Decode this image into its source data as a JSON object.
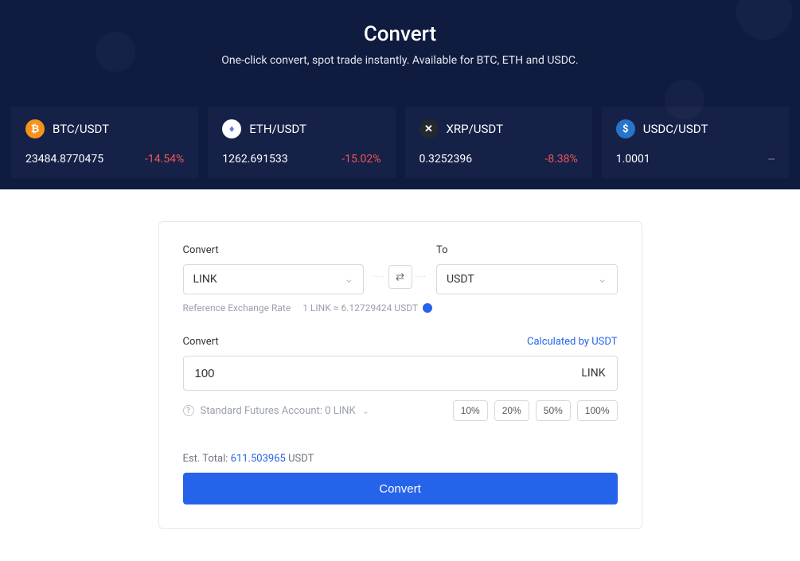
{
  "hero": {
    "title": "Convert",
    "subtitle": "One-click convert, spot trade instantly. Available for BTC, ETH and USDC."
  },
  "tickers": [
    {
      "pair": "BTC/USDT",
      "price": "23484.8770475",
      "change": "-14.54%",
      "changeClass": "neg",
      "iconClass": "coin-btc",
      "iconGlyph": "₿"
    },
    {
      "pair": "ETH/USDT",
      "price": "1262.691533",
      "change": "-15.02%",
      "changeClass": "neg",
      "iconClass": "coin-eth",
      "iconGlyph": "♦"
    },
    {
      "pair": "XRP/USDT",
      "price": "0.3252396",
      "change": "-8.38%",
      "changeClass": "neg",
      "iconClass": "coin-xrp",
      "iconGlyph": "✕"
    },
    {
      "pair": "USDC/USDT",
      "price": "1.0001",
      "change": "--",
      "changeClass": "neutral",
      "iconClass": "coin-usdc",
      "iconGlyph": "$"
    }
  ],
  "form": {
    "fromLabel": "Convert",
    "toLabel": "To",
    "fromValue": "LINK",
    "toValue": "USDT",
    "rateLabel": "Reference Exchange Rate",
    "rateText": "1 LINK ≈ 6.12729424 USDT",
    "amountLabel": "Convert",
    "calcBy": "Calculated by USDT",
    "amountValue": "100",
    "amountUnit": "LINK",
    "accountText": "Standard Futures Account: 0 LINK",
    "pct": [
      "10%",
      "20%",
      "50%",
      "100%"
    ],
    "estLabel": "Est. Total: ",
    "estValue": "611.503965",
    "estUnit": " USDT",
    "button": "Convert"
  }
}
